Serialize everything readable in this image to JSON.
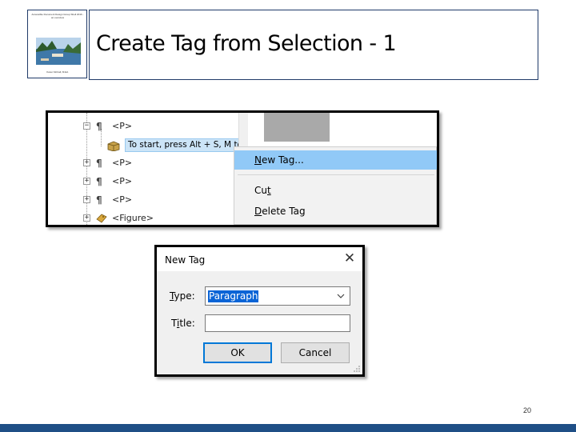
{
  "slide": {
    "title": "Create Tag from Selection  - 1",
    "page_number": "20"
  },
  "thumbnail": {
    "title_text": "Accessible Document Design Group Shell 2016 - an overview",
    "footer_text": "Karen McCall, M.Ed."
  },
  "tag_tree": {
    "rows": [
      {
        "label": "<P>",
        "expander": "−"
      },
      {
        "label": "To start, press Alt + S, M to",
        "selected": true
      },
      {
        "label": "<P>",
        "expander": "+"
      },
      {
        "label": "<P>",
        "expander": "+"
      },
      {
        "label": "<P>",
        "expander": "+"
      },
      {
        "label": "<Figure>",
        "expander": "+"
      }
    ]
  },
  "context_menu": {
    "items": [
      {
        "label": "New Tag...",
        "access_key": "N",
        "highlighted": true
      },
      {
        "label": "Cut",
        "access_key": "t"
      },
      {
        "label": "Delete Tag",
        "access_key": "D"
      }
    ]
  },
  "dialog": {
    "title": "New Tag",
    "close_glyph": "✕",
    "type_label": "Type:",
    "type_value": "Paragraph",
    "title_label": "Title:",
    "title_value": "",
    "ok_label": "OK",
    "cancel_label": "Cancel"
  },
  "colors": {
    "accent_bar": "#1f4f86",
    "menu_highlight": "#91c9f7",
    "selection_blue": "#0a64d6"
  }
}
